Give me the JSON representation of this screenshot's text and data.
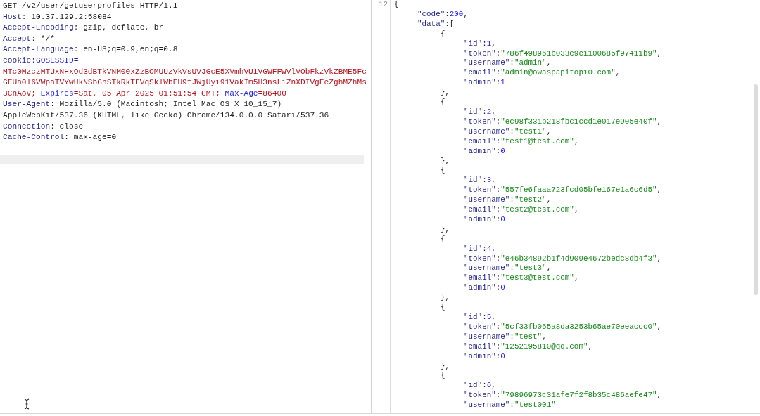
{
  "request": {
    "lines": [
      {
        "tokens": [
          {
            "kind": "plain",
            "text": "GET /v2/user/getuserprofiles HTTP/1.1"
          }
        ]
      },
      {
        "tokens": [
          {
            "kind": "key",
            "text": "Host"
          },
          {
            "kind": "plain",
            "text": ": 10.37.129.2:58084"
          }
        ]
      },
      {
        "tokens": [
          {
            "kind": "key",
            "text": "Accept-Encoding"
          },
          {
            "kind": "plain",
            "text": ": gzip, deflate, br"
          }
        ]
      },
      {
        "tokens": [
          {
            "kind": "key",
            "text": "Accept"
          },
          {
            "kind": "plain",
            "text": ": */*"
          }
        ]
      },
      {
        "tokens": [
          {
            "kind": "key",
            "text": "Accept-Language"
          },
          {
            "kind": "plain",
            "text": ": en-US;q=0.9,en;q=0.8"
          }
        ]
      },
      {
        "tokens": [
          {
            "kind": "key",
            "text": "cookie:"
          },
          {
            "kind": "attr",
            "text": "GOSESSID"
          },
          {
            "kind": "key",
            "text": "="
          }
        ]
      },
      {
        "tokens": [
          {
            "kind": "value",
            "text": "MTc0MzczMTUxNHxOd3dBTkVNM00xZzBOMUUzVkVsUVJGcE5XVmhVU1VGWFFWVlVObFkzVkZBME5Fc"
          }
        ]
      },
      {
        "tokens": [
          {
            "kind": "value",
            "text": "GFUa0l6VWpaTVYwUkNSbGhSTkRkTFVqSklWbEU9fJWjUyi91VakIm5H3nsLiZnXDIVgFeZghMZhMs"
          }
        ]
      },
      {
        "tokens": [
          {
            "kind": "value",
            "text": "3CnAoV; "
          },
          {
            "kind": "attr",
            "text": "Expires"
          },
          {
            "kind": "value",
            "text": "=Sat, 05 Apr 2025 01:51:54 GMT; "
          },
          {
            "kind": "attr",
            "text": "Max-Age"
          },
          {
            "kind": "value",
            "text": "=86400"
          }
        ]
      },
      {
        "tokens": [
          {
            "kind": "key",
            "text": "User-Agent"
          },
          {
            "kind": "plain",
            "text": ": Mozilla/5.0 (Macintosh; Intel Mac OS X 10_15_7)"
          }
        ]
      },
      {
        "tokens": [
          {
            "kind": "plain",
            "text": "AppleWebKit/537.36 (KHTML, like Gecko) Chrome/134.0.0.0 Safari/537.36"
          }
        ]
      },
      {
        "tokens": [
          {
            "kind": "key",
            "text": "Connection"
          },
          {
            "kind": "plain",
            "text": ": close"
          }
        ]
      },
      {
        "tokens": [
          {
            "kind": "key",
            "text": "Cache-Control"
          },
          {
            "kind": "plain",
            "text": ": max-age=0"
          }
        ]
      }
    ]
  },
  "response": {
    "line_number": "12",
    "lines": [
      {
        "tokens": [
          {
            "kind": "punct",
            "text": "{"
          }
        ],
        "children": [
          {
            "tokens": [
              {
                "kind": "key",
                "text": "\"code\""
              },
              {
                "kind": "punct",
                "text": ":"
              },
              {
                "kind": "num",
                "text": "200"
              },
              {
                "kind": "punct",
                "text": ","
              }
            ]
          },
          {
            "tokens": [
              {
                "kind": "key",
                "text": "\"data\""
              },
              {
                "kind": "punct",
                "text": ":["
              }
            ],
            "children": [
              {
                "tokens": [
                  {
                    "kind": "punct",
                    "text": "{"
                  }
                ],
                "children": [
                  {
                    "tokens": [
                      {
                        "kind": "key",
                        "text": "\"id\""
                      },
                      {
                        "kind": "punct",
                        "text": ":"
                      },
                      {
                        "kind": "num",
                        "text": "1"
                      },
                      {
                        "kind": "punct",
                        "text": ","
                      }
                    ]
                  },
                  {
                    "tokens": [
                      {
                        "kind": "key",
                        "text": "\"token\""
                      },
                      {
                        "kind": "punct",
                        "text": ":"
                      },
                      {
                        "kind": "str",
                        "text": "\"786f498961b033e9e1100685f97411b9\""
                      },
                      {
                        "kind": "punct",
                        "text": ","
                      }
                    ]
                  },
                  {
                    "tokens": [
                      {
                        "kind": "key",
                        "text": "\"username\""
                      },
                      {
                        "kind": "punct",
                        "text": ":"
                      },
                      {
                        "kind": "str",
                        "text": "\"admin\""
                      },
                      {
                        "kind": "punct",
                        "text": ","
                      }
                    ]
                  },
                  {
                    "tokens": [
                      {
                        "kind": "key",
                        "text": "\"email\""
                      },
                      {
                        "kind": "punct",
                        "text": ":"
                      },
                      {
                        "kind": "str",
                        "text": "\"admin@owaspapitop10.com\""
                      },
                      {
                        "kind": "punct",
                        "text": ","
                      }
                    ]
                  },
                  {
                    "tokens": [
                      {
                        "kind": "key",
                        "text": "\"admin\""
                      },
                      {
                        "kind": "punct",
                        "text": ":"
                      },
                      {
                        "kind": "num",
                        "text": "1"
                      }
                    ]
                  }
                ]
              },
              {
                "tokens": [
                  {
                    "kind": "punct",
                    "text": "},"
                  }
                ]
              },
              {
                "tokens": [
                  {
                    "kind": "punct",
                    "text": "{"
                  }
                ],
                "children": [
                  {
                    "tokens": [
                      {
                        "kind": "key",
                        "text": "\"id\""
                      },
                      {
                        "kind": "punct",
                        "text": ":"
                      },
                      {
                        "kind": "num",
                        "text": "2"
                      },
                      {
                        "kind": "punct",
                        "text": ","
                      }
                    ]
                  },
                  {
                    "tokens": [
                      {
                        "kind": "key",
                        "text": "\"token\""
                      },
                      {
                        "kind": "punct",
                        "text": ":"
                      },
                      {
                        "kind": "str",
                        "text": "\"ec98f331b218fbc1ccd1e017e905e40f\""
                      },
                      {
                        "kind": "punct",
                        "text": ","
                      }
                    ]
                  },
                  {
                    "tokens": [
                      {
                        "kind": "key",
                        "text": "\"username\""
                      },
                      {
                        "kind": "punct",
                        "text": ":"
                      },
                      {
                        "kind": "str",
                        "text": "\"test1\""
                      },
                      {
                        "kind": "punct",
                        "text": ","
                      }
                    ]
                  },
                  {
                    "tokens": [
                      {
                        "kind": "key",
                        "text": "\"email\""
                      },
                      {
                        "kind": "punct",
                        "text": ":"
                      },
                      {
                        "kind": "str",
                        "text": "\"test1@test.com\""
                      },
                      {
                        "kind": "punct",
                        "text": ","
                      }
                    ]
                  },
                  {
                    "tokens": [
                      {
                        "kind": "key",
                        "text": "\"admin\""
                      },
                      {
                        "kind": "punct",
                        "text": ":"
                      },
                      {
                        "kind": "num",
                        "text": "0"
                      }
                    ]
                  }
                ]
              },
              {
                "tokens": [
                  {
                    "kind": "punct",
                    "text": "},"
                  }
                ]
              },
              {
                "tokens": [
                  {
                    "kind": "punct",
                    "text": "{"
                  }
                ],
                "children": [
                  {
                    "tokens": [
                      {
                        "kind": "key",
                        "text": "\"id\""
                      },
                      {
                        "kind": "punct",
                        "text": ":"
                      },
                      {
                        "kind": "num",
                        "text": "3"
                      },
                      {
                        "kind": "punct",
                        "text": ","
                      }
                    ]
                  },
                  {
                    "tokens": [
                      {
                        "kind": "key",
                        "text": "\"token\""
                      },
                      {
                        "kind": "punct",
                        "text": ":"
                      },
                      {
                        "kind": "str",
                        "text": "\"557fe6faaa723fcd05bfe167e1a6c6d5\""
                      },
                      {
                        "kind": "punct",
                        "text": ","
                      }
                    ]
                  },
                  {
                    "tokens": [
                      {
                        "kind": "key",
                        "text": "\"username\""
                      },
                      {
                        "kind": "punct",
                        "text": ":"
                      },
                      {
                        "kind": "str",
                        "text": "\"test2\""
                      },
                      {
                        "kind": "punct",
                        "text": ","
                      }
                    ]
                  },
                  {
                    "tokens": [
                      {
                        "kind": "key",
                        "text": "\"email\""
                      },
                      {
                        "kind": "punct",
                        "text": ":"
                      },
                      {
                        "kind": "str",
                        "text": "\"test2@test.com\""
                      },
                      {
                        "kind": "punct",
                        "text": ","
                      }
                    ]
                  },
                  {
                    "tokens": [
                      {
                        "kind": "key",
                        "text": "\"admin\""
                      },
                      {
                        "kind": "punct",
                        "text": ":"
                      },
                      {
                        "kind": "num",
                        "text": "0"
                      }
                    ]
                  }
                ]
              },
              {
                "tokens": [
                  {
                    "kind": "punct",
                    "text": "},"
                  }
                ]
              },
              {
                "tokens": [
                  {
                    "kind": "punct",
                    "text": "{"
                  }
                ],
                "children": [
                  {
                    "tokens": [
                      {
                        "kind": "key",
                        "text": "\"id\""
                      },
                      {
                        "kind": "punct",
                        "text": ":"
                      },
                      {
                        "kind": "num",
                        "text": "4"
                      },
                      {
                        "kind": "punct",
                        "text": ","
                      }
                    ]
                  },
                  {
                    "tokens": [
                      {
                        "kind": "key",
                        "text": "\"token\""
                      },
                      {
                        "kind": "punct",
                        "text": ":"
                      },
                      {
                        "kind": "str",
                        "text": "\"e46b34892b1f4d909e4672bedc8db4f3\""
                      },
                      {
                        "kind": "punct",
                        "text": ","
                      }
                    ]
                  },
                  {
                    "tokens": [
                      {
                        "kind": "key",
                        "text": "\"username\""
                      },
                      {
                        "kind": "punct",
                        "text": ":"
                      },
                      {
                        "kind": "str",
                        "text": "\"test3\""
                      },
                      {
                        "kind": "punct",
                        "text": ","
                      }
                    ]
                  },
                  {
                    "tokens": [
                      {
                        "kind": "key",
                        "text": "\"email\""
                      },
                      {
                        "kind": "punct",
                        "text": ":"
                      },
                      {
                        "kind": "str",
                        "text": "\"test3@test.com\""
                      },
                      {
                        "kind": "punct",
                        "text": ","
                      }
                    ]
                  },
                  {
                    "tokens": [
                      {
                        "kind": "key",
                        "text": "\"admin\""
                      },
                      {
                        "kind": "punct",
                        "text": ":"
                      },
                      {
                        "kind": "num",
                        "text": "0"
                      }
                    ]
                  }
                ]
              },
              {
                "tokens": [
                  {
                    "kind": "punct",
                    "text": "},"
                  }
                ]
              },
              {
                "tokens": [
                  {
                    "kind": "punct",
                    "text": "{"
                  }
                ],
                "children": [
                  {
                    "tokens": [
                      {
                        "kind": "key",
                        "text": "\"id\""
                      },
                      {
                        "kind": "punct",
                        "text": ":"
                      },
                      {
                        "kind": "num",
                        "text": "5"
                      },
                      {
                        "kind": "punct",
                        "text": ","
                      }
                    ]
                  },
                  {
                    "tokens": [
                      {
                        "kind": "key",
                        "text": "\"token\""
                      },
                      {
                        "kind": "punct",
                        "text": ":"
                      },
                      {
                        "kind": "str",
                        "text": "\"5cf33fb065a8da3253b65ae70eeaccc0\""
                      },
                      {
                        "kind": "punct",
                        "text": ","
                      }
                    ]
                  },
                  {
                    "tokens": [
                      {
                        "kind": "key",
                        "text": "\"username\""
                      },
                      {
                        "kind": "punct",
                        "text": ":"
                      },
                      {
                        "kind": "str",
                        "text": "\"test\""
                      },
                      {
                        "kind": "punct",
                        "text": ","
                      }
                    ]
                  },
                  {
                    "tokens": [
                      {
                        "kind": "key",
                        "text": "\"email\""
                      },
                      {
                        "kind": "punct",
                        "text": ":"
                      },
                      {
                        "kind": "str",
                        "text": "\"1252195810@qq.com\""
                      },
                      {
                        "kind": "punct",
                        "text": ","
                      }
                    ]
                  },
                  {
                    "tokens": [
                      {
                        "kind": "key",
                        "text": "\"admin\""
                      },
                      {
                        "kind": "punct",
                        "text": ":"
                      },
                      {
                        "kind": "num",
                        "text": "0"
                      }
                    ]
                  }
                ]
              },
              {
                "tokens": [
                  {
                    "kind": "punct",
                    "text": "},"
                  }
                ]
              },
              {
                "tokens": [
                  {
                    "kind": "punct",
                    "text": "{"
                  }
                ],
                "children": [
                  {
                    "tokens": [
                      {
                        "kind": "key",
                        "text": "\"id\""
                      },
                      {
                        "kind": "punct",
                        "text": ":"
                      },
                      {
                        "kind": "num",
                        "text": "6"
                      },
                      {
                        "kind": "punct",
                        "text": ","
                      }
                    ]
                  },
                  {
                    "tokens": [
                      {
                        "kind": "key",
                        "text": "\"token\""
                      },
                      {
                        "kind": "punct",
                        "text": ":"
                      },
                      {
                        "kind": "str",
                        "text": "\"79896973c31afe7f2f8b35c486aefe47\""
                      },
                      {
                        "kind": "punct",
                        "text": ","
                      }
                    ]
                  },
                  {
                    "tokens": [
                      {
                        "kind": "key",
                        "text": "\"username\""
                      },
                      {
                        "kind": "punct",
                        "text": ":"
                      },
                      {
                        "kind": "str",
                        "text": "\"test001\""
                      }
                    ]
                  }
                ]
              }
            ]
          }
        ]
      }
    ]
  }
}
